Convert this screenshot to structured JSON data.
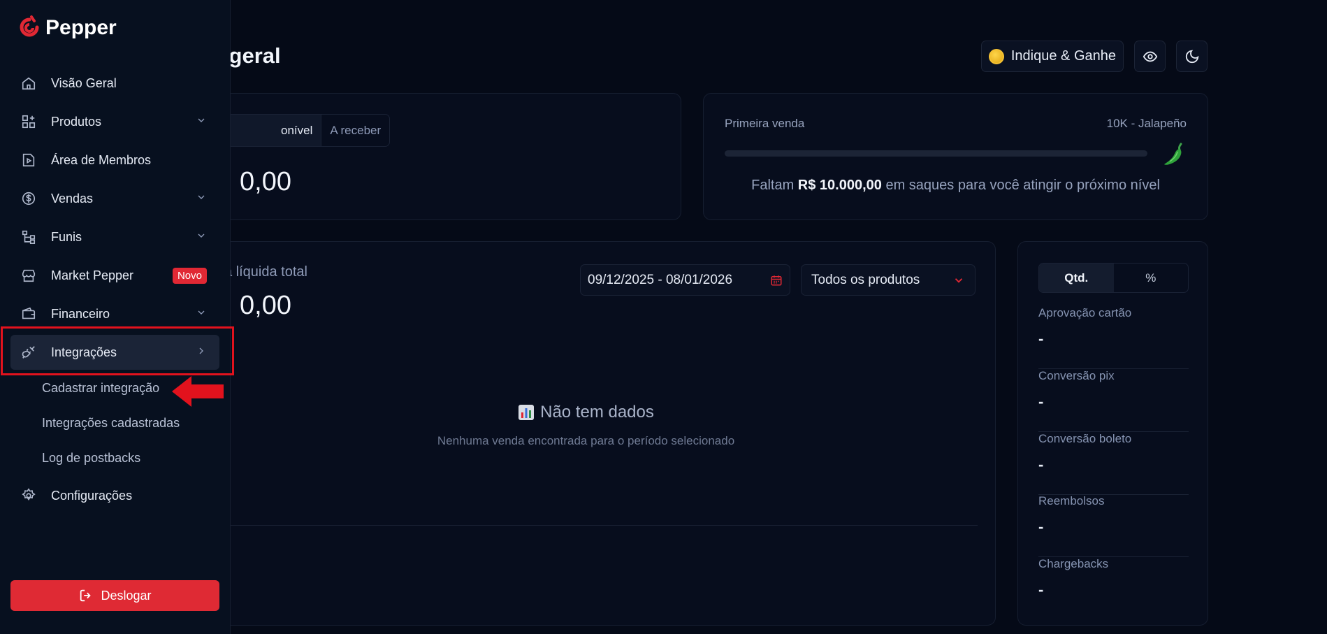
{
  "brand": {
    "name": "Pepper",
    "accent": "#e12834"
  },
  "header": {
    "title": "o geral",
    "indique_label": "Indique & Ganhe"
  },
  "balance_card": {
    "tab_available": "onível",
    "tab_receivable": "A receber",
    "value": "0,00"
  },
  "level_card": {
    "left_label": "Primeira venda",
    "right_label": "10K - Jalapeño",
    "progress": 0,
    "msg_prefix": "Faltam",
    "msg_amount": "R$ 10.000,00",
    "msg_suffix": "em saques para você atingir o próximo nível"
  },
  "sales_card": {
    "label": "ita líquida total",
    "value": "0,00",
    "date_range": "09/12/2025 - 08/01/2026",
    "product_filter": "Todos os produtos",
    "nodata_title": "Não tem dados",
    "nodata_sub": "Nenhuma venda encontrada para o período selecionado"
  },
  "stats_card": {
    "tabs": [
      "Qtd.",
      "%"
    ],
    "items": [
      {
        "label": "Aprovação cartão",
        "value": "-"
      },
      {
        "label": "Conversão pix",
        "value": "-"
      },
      {
        "label": "Conversão boleto",
        "value": "-"
      },
      {
        "label": "Reembolsos",
        "value": "-"
      },
      {
        "label": "Chargebacks",
        "value": "-"
      }
    ]
  },
  "sidebar": {
    "items": [
      {
        "label": "Visão Geral",
        "icon": "home-icon"
      },
      {
        "label": "Produtos",
        "icon": "grid-plus-icon"
      },
      {
        "label": "Área de Membros",
        "icon": "play-file-icon"
      },
      {
        "label": "Vendas",
        "icon": "dollar-circle-icon"
      },
      {
        "label": "Funis",
        "icon": "funnel-tree-icon"
      },
      {
        "label": "Market Pepper",
        "icon": "store-icon",
        "badge": "Novo"
      },
      {
        "label": "Financeiro",
        "icon": "wallet-icon"
      },
      {
        "label": "Integrações",
        "icon": "plug-icon"
      },
      {
        "label": "Configurações",
        "icon": "gear-icon"
      }
    ],
    "sub_items": [
      "Cadastrar integração",
      "Integrações cadastradas",
      "Log de postbacks"
    ],
    "logout_label": "Deslogar"
  }
}
